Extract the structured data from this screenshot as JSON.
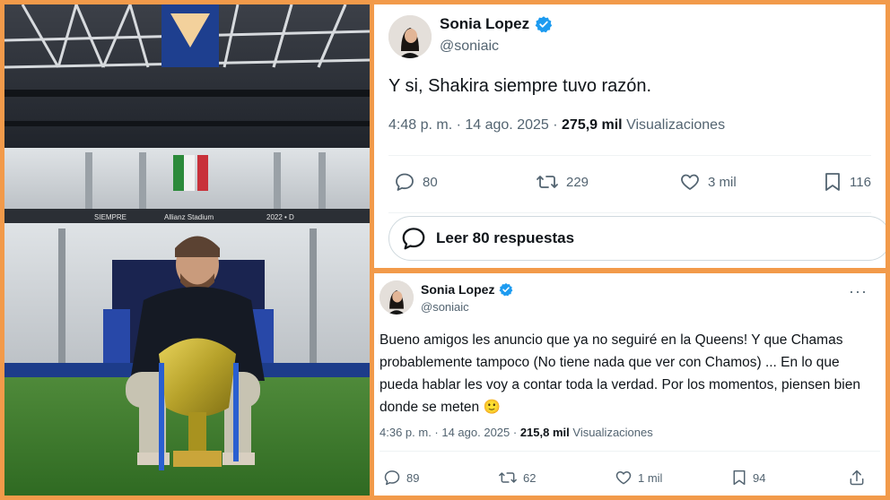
{
  "tweet_top": {
    "name": "Sonia Lopez",
    "handle": "@soniaic",
    "text": "Y si, Shakira siempre tuvo razón.",
    "time": "4:48 p. m. · 14 ago. 2025 · ",
    "views_count": "275,9 mil",
    "views_label": " Visualizaciones",
    "replies": "80",
    "retweets": "229",
    "likes": "3 mil",
    "bookmarks": "116",
    "read_replies": "Leer 80 respuestas"
  },
  "tweet_bottom": {
    "name": "Sonia Lopez",
    "handle": "@soniaic",
    "more": "···",
    "text": "Bueno amigos les anuncio que ya no seguiré en la Queens! Y que Chamas probablemente tampoco (No tiene nada que ver con Chamos) ... En lo que pueda hablar les voy a contar toda la verdad. Por los momentos, piensen bien donde se meten 🙂",
    "time": "4:36 p. m. · 14 ago. 2025 · ",
    "views_count": "215,8 mil",
    "views_label": " Visualizaciones",
    "replies": "89",
    "retweets": "62",
    "likes": "1 mil",
    "bookmarks": "94"
  },
  "photo": {
    "banner_left": "SIEMPRE",
    "banner_mid": "Allianz Stadium",
    "banner_right": "2022 • D"
  },
  "colors": {
    "border": "#F29A4A",
    "verified": "#1D9BF0",
    "muted": "#536471",
    "text": "#0F1419"
  }
}
